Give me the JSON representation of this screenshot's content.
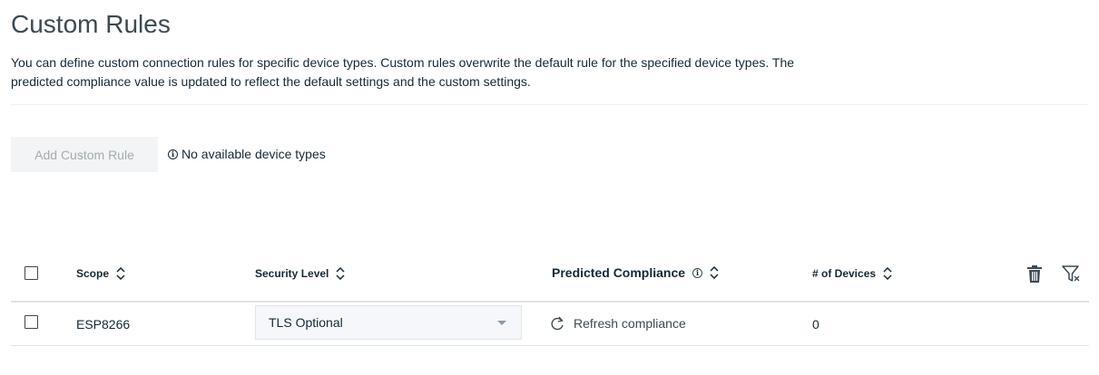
{
  "page": {
    "title": "Custom Rules",
    "description": "You can define custom connection rules for specific device types. Custom rules overwrite the default rule for the specified device types. The predicted compliance value is updated to reflect the default settings and the custom settings."
  },
  "actions": {
    "add_label": "Add Custom Rule",
    "notice": "No available device types",
    "notice_icon": "info-icon"
  },
  "table": {
    "columns": {
      "scope": "Scope",
      "security_level": "Security Level",
      "predicted_compliance": "Predicted Compliance",
      "devices": "# of Devices"
    },
    "toolbar_icons": [
      "trash-icon",
      "filter-icon"
    ],
    "rows": [
      {
        "scope": "ESP8266",
        "security_level": "TLS Optional",
        "compliance_action": "Refresh compliance",
        "devices": "0"
      }
    ]
  },
  "colors": {
    "text": "#152935",
    "disabled_button_bg": "#f2f4f5",
    "disabled_button_text": "#a3acb1",
    "border": "#dfe3e6"
  }
}
